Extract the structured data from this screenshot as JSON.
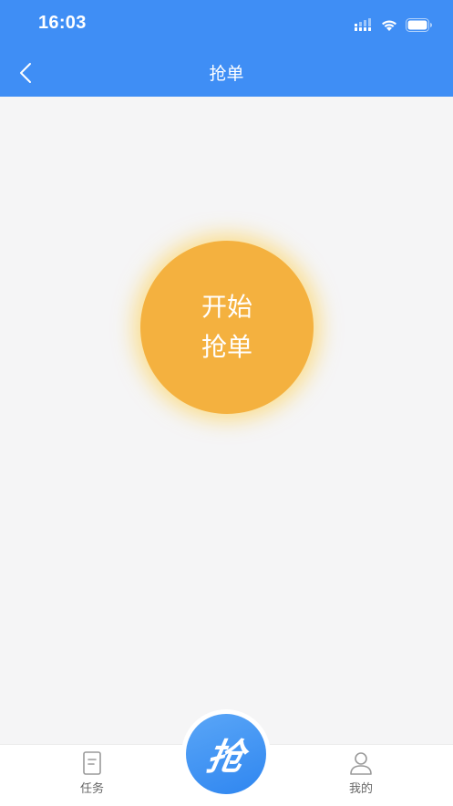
{
  "status_bar": {
    "time": "16:03"
  },
  "nav": {
    "title": "抢单",
    "back_icon": "chevron-left-icon"
  },
  "main": {
    "grab_button": {
      "line1": "开始",
      "line2": "抢单",
      "color": "#f4b13f"
    }
  },
  "tab_bar": {
    "tasks_label": "任务",
    "center_label": "抢",
    "mine_label": "我的"
  },
  "colors": {
    "header": "#3f8ef5",
    "background": "#f5f5f6",
    "accent_orange": "#f4b13f",
    "tab_icon_gray": "#9a9a9a"
  }
}
